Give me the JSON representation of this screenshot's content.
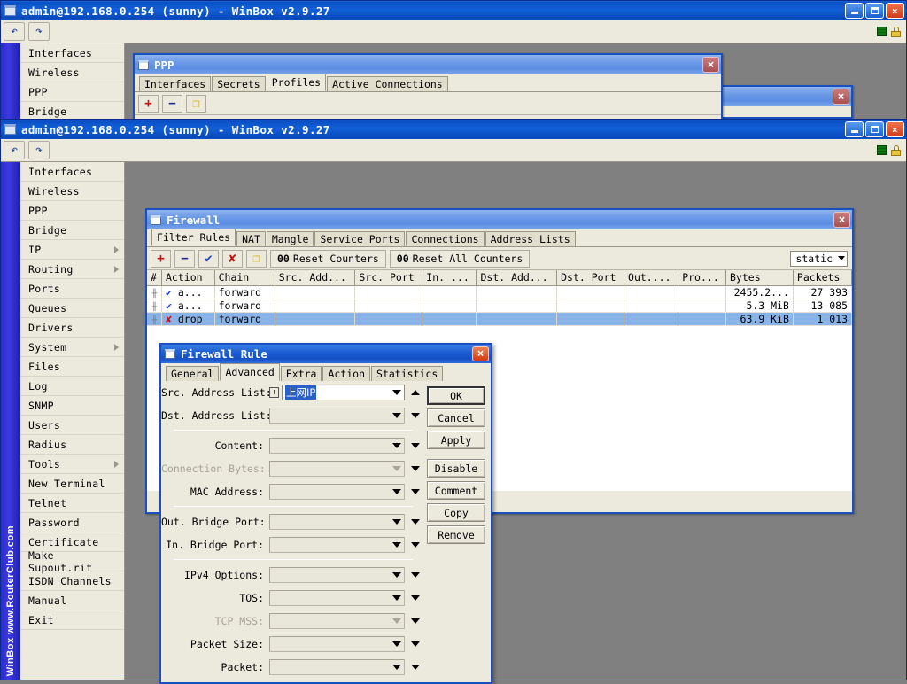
{
  "window_title": "admin@192.168.0.254 (sunny) - WinBox v2.9.27",
  "watermark": "WinBox   www.RouterClub.com",
  "titlebar": {
    "minimize_label": "minimize",
    "restore_label": "restore",
    "close_label": "×"
  },
  "toolbar": {
    "undo_label": "↶",
    "redo_label": "↷"
  },
  "sidebar": {
    "items_back": [
      {
        "label": "Interfaces",
        "arrow": false
      },
      {
        "label": "Wireless",
        "arrow": false
      },
      {
        "label": "PPP",
        "arrow": false
      },
      {
        "label": "Bridge",
        "arrow": false
      }
    ],
    "items": [
      {
        "label": "Interfaces",
        "arrow": false
      },
      {
        "label": "Wireless",
        "arrow": false
      },
      {
        "label": "PPP",
        "arrow": false
      },
      {
        "label": "Bridge",
        "arrow": false
      },
      {
        "label": "IP",
        "arrow": true
      },
      {
        "label": "Routing",
        "arrow": true
      },
      {
        "label": "Ports",
        "arrow": false
      },
      {
        "label": "Queues",
        "arrow": false
      },
      {
        "label": "Drivers",
        "arrow": false
      },
      {
        "label": "System",
        "arrow": true
      },
      {
        "label": "Files",
        "arrow": false
      },
      {
        "label": "Log",
        "arrow": false
      },
      {
        "label": "SNMP",
        "arrow": false
      },
      {
        "label": "Users",
        "arrow": false
      },
      {
        "label": "Radius",
        "arrow": false
      },
      {
        "label": "Tools",
        "arrow": true
      },
      {
        "label": "New Terminal",
        "arrow": false
      },
      {
        "label": "Telnet",
        "arrow": false
      },
      {
        "label": "Password",
        "arrow": false
      },
      {
        "label": "Certificate",
        "arrow": false
      },
      {
        "label": "Make Supout.rif",
        "arrow": false
      },
      {
        "label": "ISDN Channels",
        "arrow": false
      },
      {
        "label": "Manual",
        "arrow": false
      },
      {
        "label": "Exit",
        "arrow": false
      }
    ]
  },
  "ppp_window": {
    "title": "PPP",
    "close_label": "×",
    "tabs": [
      {
        "label": "Interfaces",
        "active": false
      },
      {
        "label": "Secrets",
        "active": false
      },
      {
        "label": "Profiles",
        "active": true
      },
      {
        "label": "Active Connections",
        "active": false
      }
    ],
    "toolbar": {
      "add_label": "+",
      "remove_label": "−",
      "copy_label": "❐"
    }
  },
  "firewall_window": {
    "title": "Firewall",
    "close_label": "×",
    "tabs": [
      {
        "label": "Filter Rules",
        "active": true
      },
      {
        "label": "NAT",
        "active": false
      },
      {
        "label": "Mangle",
        "active": false
      },
      {
        "label": "Service Ports",
        "active": false
      },
      {
        "label": "Connections",
        "active": false
      },
      {
        "label": "Address Lists",
        "active": false
      }
    ],
    "toolbar": {
      "add_label": "+",
      "remove_label": "−",
      "enable_label": "✔",
      "disable_label": "✘",
      "comment_label": "❐",
      "reset_counters_num": "00",
      "reset_counters_label": "Reset Counters",
      "reset_all_counters_num": "00",
      "reset_all_counters_label": "Reset All Counters",
      "filter_selected": "static"
    },
    "table": {
      "columns": [
        "#",
        "Action",
        "Chain",
        "Src. Add...",
        "Src. Port",
        "In. ...",
        "Dst. Add...",
        "Dst. Port",
        "Out....",
        "Pro...",
        "Bytes",
        "Packets"
      ],
      "rows": [
        {
          "num": "",
          "action_icon": "check",
          "action": "a...",
          "chain": "forward",
          "src_address": "",
          "src_port": "",
          "in_iface": "",
          "dst_address": "",
          "dst_port": "",
          "out_iface": "",
          "protocol": "",
          "bytes": "2455.2...",
          "packets": "27 393",
          "selected": false
        },
        {
          "num": "",
          "action_icon": "check",
          "action": "a...",
          "chain": "forward",
          "src_address": "",
          "src_port": "",
          "in_iface": "",
          "dst_address": "",
          "dst_port": "",
          "out_iface": "",
          "protocol": "",
          "bytes": "5.3 MiB",
          "packets": "13 085",
          "selected": false
        },
        {
          "num": "",
          "action_icon": "cross",
          "action": "drop",
          "chain": "forward",
          "src_address": "",
          "src_port": "",
          "in_iface": "",
          "dst_address": "",
          "dst_port": "",
          "out_iface": "",
          "protocol": "",
          "bytes": "63.9 KiB",
          "packets": "1 013",
          "selected": true
        }
      ]
    }
  },
  "rule_dialog": {
    "title": "Firewall Rule",
    "close_label": "×",
    "tabs": [
      {
        "label": "General",
        "active": false
      },
      {
        "label": "Advanced",
        "active": true
      },
      {
        "label": "Extra",
        "active": false
      },
      {
        "label": "Action",
        "active": false
      },
      {
        "label": "Statistics",
        "active": false
      }
    ],
    "fields": [
      {
        "label": "Src. Address List:",
        "value": "上网IP",
        "disabled": false,
        "selected": true,
        "prefix_icon": true,
        "caret": "up"
      },
      {
        "label": "Dst. Address List:",
        "value": "",
        "disabled": false,
        "selected": false,
        "prefix_icon": false,
        "caret": "down"
      },
      {
        "sep": true
      },
      {
        "label": "Content:",
        "value": "",
        "disabled": false,
        "selected": false,
        "prefix_icon": false,
        "caret": "down"
      },
      {
        "label": "Connection Bytes:",
        "value": "",
        "disabled": true,
        "selected": false,
        "prefix_icon": false,
        "caret": "down"
      },
      {
        "label": "MAC Address:",
        "value": "",
        "disabled": false,
        "selected": false,
        "prefix_icon": false,
        "caret": "down"
      },
      {
        "sep": true
      },
      {
        "label": "Out. Bridge Port:",
        "value": "",
        "disabled": false,
        "selected": false,
        "prefix_icon": false,
        "caret": "down"
      },
      {
        "label": "In. Bridge Port:",
        "value": "",
        "disabled": false,
        "selected": false,
        "prefix_icon": false,
        "caret": "down"
      },
      {
        "sep": true
      },
      {
        "label": "IPv4 Options:",
        "value": "",
        "disabled": false,
        "selected": false,
        "prefix_icon": false,
        "caret": "down"
      },
      {
        "label": "TOS:",
        "value": "",
        "disabled": false,
        "selected": false,
        "prefix_icon": false,
        "caret": "down"
      },
      {
        "label": "TCP MSS:",
        "value": "",
        "disabled": true,
        "selected": false,
        "prefix_icon": false,
        "caret": "down"
      },
      {
        "label": "Packet Size:",
        "value": "",
        "disabled": false,
        "selected": false,
        "prefix_icon": false,
        "caret": "down"
      },
      {
        "label": "Packet:",
        "value": "",
        "disabled": false,
        "selected": false,
        "prefix_icon": false,
        "caret": "down"
      }
    ],
    "buttons": [
      {
        "label": "OK",
        "default": true,
        "gap": false
      },
      {
        "label": "Cancel",
        "default": false,
        "gap": false
      },
      {
        "label": "Apply",
        "default": false,
        "gap": false
      },
      {
        "label": "Disable",
        "default": false,
        "gap": true
      },
      {
        "label": "Comment",
        "default": false,
        "gap": false
      },
      {
        "label": "Copy",
        "default": false,
        "gap": false
      },
      {
        "label": "Remove",
        "default": false,
        "gap": false
      }
    ]
  }
}
